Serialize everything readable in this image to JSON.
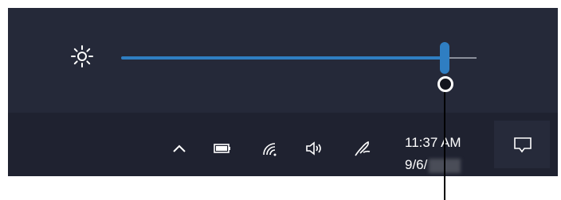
{
  "brightness": {
    "icon": "brightness-sun-icon",
    "level_percent": 91
  },
  "tray": {
    "icons": [
      "show-hidden-icons-chevron-icon",
      "battery-icon",
      "wifi-icon",
      "volume-icon",
      "pen-ink-workspace-icon"
    ]
  },
  "clock": {
    "time": "11:37 AM",
    "date_visible": "9/6/"
  },
  "action_center": {
    "icon": "action-center-notification-icon"
  },
  "colors": {
    "taskbar_bg": "#1f2230",
    "flyout_bg": "#252939",
    "accent": "#2f7ec2",
    "track_rest": "#8b8f9b",
    "icon": "#ffffff"
  }
}
